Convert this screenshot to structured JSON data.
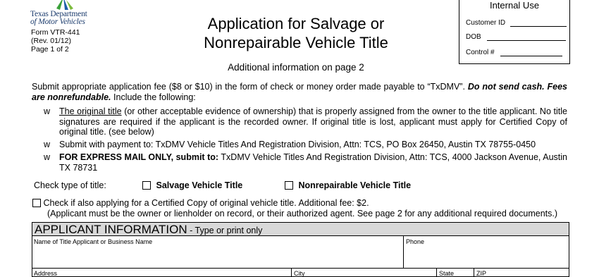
{
  "header": {
    "agency_line1": "Texas Department",
    "agency_line2": "of Motor Vehicles",
    "form_number": "Form VTR-441",
    "revision": "(Rev. 01/12)",
    "page": "Page 1 of 2",
    "title_line1": "Application for Salvage or",
    "title_line2": "Nonrepairable Vehicle Title",
    "subtitle": "Additional information on page 2"
  },
  "internal_use": {
    "heading": "Internal Use",
    "customer_id_label": "Customer ID",
    "dob_label": "DOB",
    "control_label": "Control #"
  },
  "instructions": {
    "fee_text": "Submit appropriate application fee ($8 or $10) in the form of check or money order made payable to “TxDMV”.",
    "no_cash": "Do not send cash. Fees are nonrefundable.",
    "include": "Include the following:",
    "bullet_glyph": "w",
    "bullet1_underlined": "The original title",
    "bullet1_rest": "(or other acceptable evidence of ownership) that is properly assigned from the owner to the title applicant.  No title signatures are required if the applicant is the recorded owner. If original title is lost, applicant must apply for Certified Copy of original title. (see below)",
    "bullet2": "Submit with payment to:  TxDMV Vehicle Titles And Registration Division, Attn: TCS, PO Box 26450, Austin TX  78755-0450",
    "bullet3_bold": "FOR EXPRESS MAIL ONLY, submit to:",
    "bullet3_rest": "TxDMV Vehicle Titles And Registration Division, Attn: TCS, 4000 Jackson Avenue, Austin TX  78731"
  },
  "title_type": {
    "label": "Check type of title:",
    "salvage": "Salvage Vehicle Title",
    "nonrepairable": "Nonrepairable Vehicle Title"
  },
  "certified_copy": {
    "line1": "Check if also applying for a Certified Copy of original vehicle title. Additional fee: $2.",
    "line2": "(Applicant must be the owner or lienholder on record, or their authorized agent. See page 2 for any additional required documents.)"
  },
  "applicant": {
    "heading": "APPLICANT INFORMATION",
    "heading_sub": " - Type or print only",
    "name_label": "Name of Title Applicant or Business Name",
    "phone_label": "Phone",
    "address_label": "Address",
    "city_label": "City",
    "state_label": "State",
    "zip_label": "ZIP"
  },
  "colors": {
    "agency_text": "#1d3d6e",
    "logo_blue": "#1d5fa8",
    "logo_green": "#3aa13a",
    "section_header_bg": "#d9d9d9"
  }
}
